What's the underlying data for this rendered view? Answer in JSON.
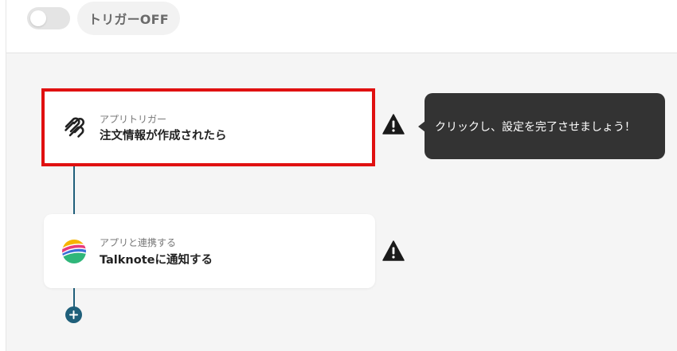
{
  "header": {
    "trigger_toggle_state": "off",
    "trigger_label": "トリガーOFF"
  },
  "flow": {
    "steps": [
      {
        "icon": "squarespace-logo-icon",
        "subtitle": "アプリトリガー",
        "title": "注文情報が作成されたら",
        "status_icon": "warning-icon",
        "highlighted": true
      },
      {
        "icon": "talknote-logo-icon",
        "subtitle": "アプリと連携する",
        "title": "Talknoteに通知する",
        "status_icon": "warning-icon",
        "highlighted": false
      }
    ],
    "add_step_icon": "plus-icon"
  },
  "tooltip": {
    "text": "クリックし、設定を完了させましょう！"
  },
  "colors": {
    "connector": "#1f5f7a",
    "highlight_border": "#e01010",
    "tooltip_bg": "#333333",
    "canvas_bg": "#f5f5f5"
  }
}
